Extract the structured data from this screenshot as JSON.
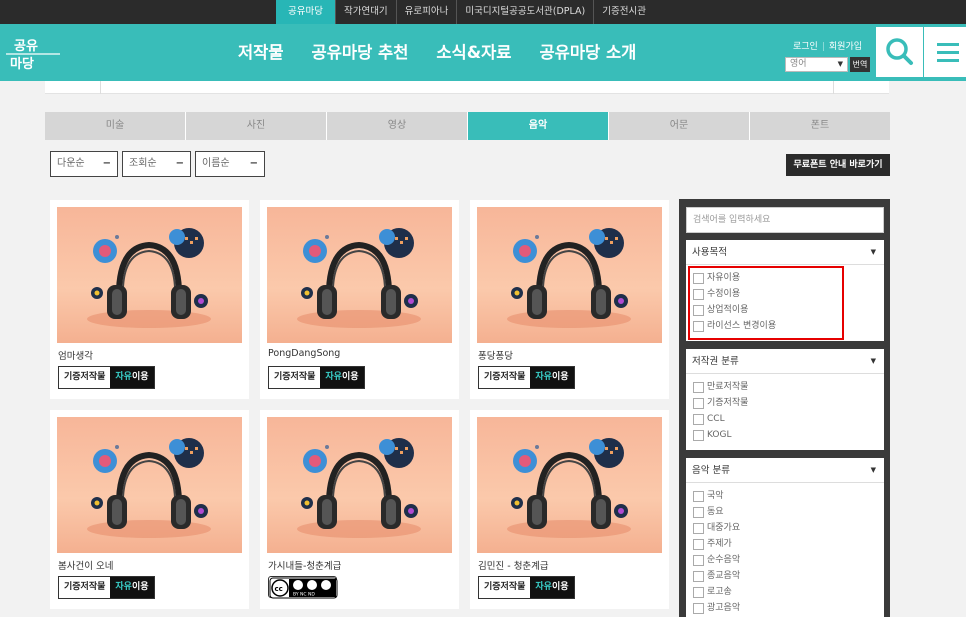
{
  "topbar": {
    "links": [
      "공유마당",
      "작가연대기",
      "유로피아나",
      "미국디지털공공도서관(DPLA)",
      "기증전시관"
    ],
    "active_index": 0
  },
  "header": {
    "logo_text": "공유마당",
    "nav": [
      "저작물",
      "공유마당 추천",
      "소식&자료",
      "공유마당 소개"
    ],
    "login": "로그인",
    "signup": "회원가입",
    "language_select": "영어",
    "translate_button": "번역",
    "search_icon": "search-icon",
    "menu_icon": "hamburger-menu-icon"
  },
  "category_tabs": [
    "미술",
    "사진",
    "영상",
    "음악",
    "어문",
    "폰트"
  ],
  "active_tab": "음악",
  "sort": {
    "options": [
      "다운순",
      "조회순",
      "이름순"
    ],
    "toggle": "−"
  },
  "font_guide_button": "무료폰트 안내 바로가기",
  "cards": [
    {
      "title": "엄마생각",
      "badge_left": "기증저작물",
      "badge_right_hl": "자유",
      "badge_right_rest": "이용"
    },
    {
      "title": "PongDangSong",
      "badge_left": "기증저작물",
      "badge_right_hl": "자유",
      "badge_right_rest": "이용"
    },
    {
      "title": "퐁당퐁당",
      "badge_left": "기증저작물",
      "badge_right_hl": "자유",
      "badge_right_rest": "이용"
    },
    {
      "title": "봄사건이 오네",
      "badge_left": "기증저작물",
      "badge_right_hl": "자유",
      "badge_right_rest": "이용"
    },
    {
      "title": "가시내들-청춘계급",
      "license": "CC BY NC ND"
    },
    {
      "title": "김민진 - 청춘계급",
      "badge_left": "기증저작물",
      "badge_right_hl": "자유",
      "badge_right_rest": "이용"
    }
  ],
  "filters": {
    "search_placeholder": "검색어를 입력하세요",
    "groups": [
      {
        "title": "사용목적",
        "items": [
          "자유이용",
          "수정이용",
          "상업적이용",
          "라이선스 변경이용"
        ]
      },
      {
        "title": "저작권 분류",
        "items": [
          "만료저작물",
          "기증저작물",
          "CCL",
          "KOGL"
        ]
      },
      {
        "title": "음악 분류",
        "items": [
          "국악",
          "동요",
          "대중가요",
          "주제가",
          "순수음악",
          "종교음악",
          "로고송",
          "광고음악"
        ]
      }
    ]
  },
  "colors": {
    "brand_teal": "#39bdb9",
    "top_dark": "#2b2b2b",
    "highlight_red": "#e60000"
  }
}
